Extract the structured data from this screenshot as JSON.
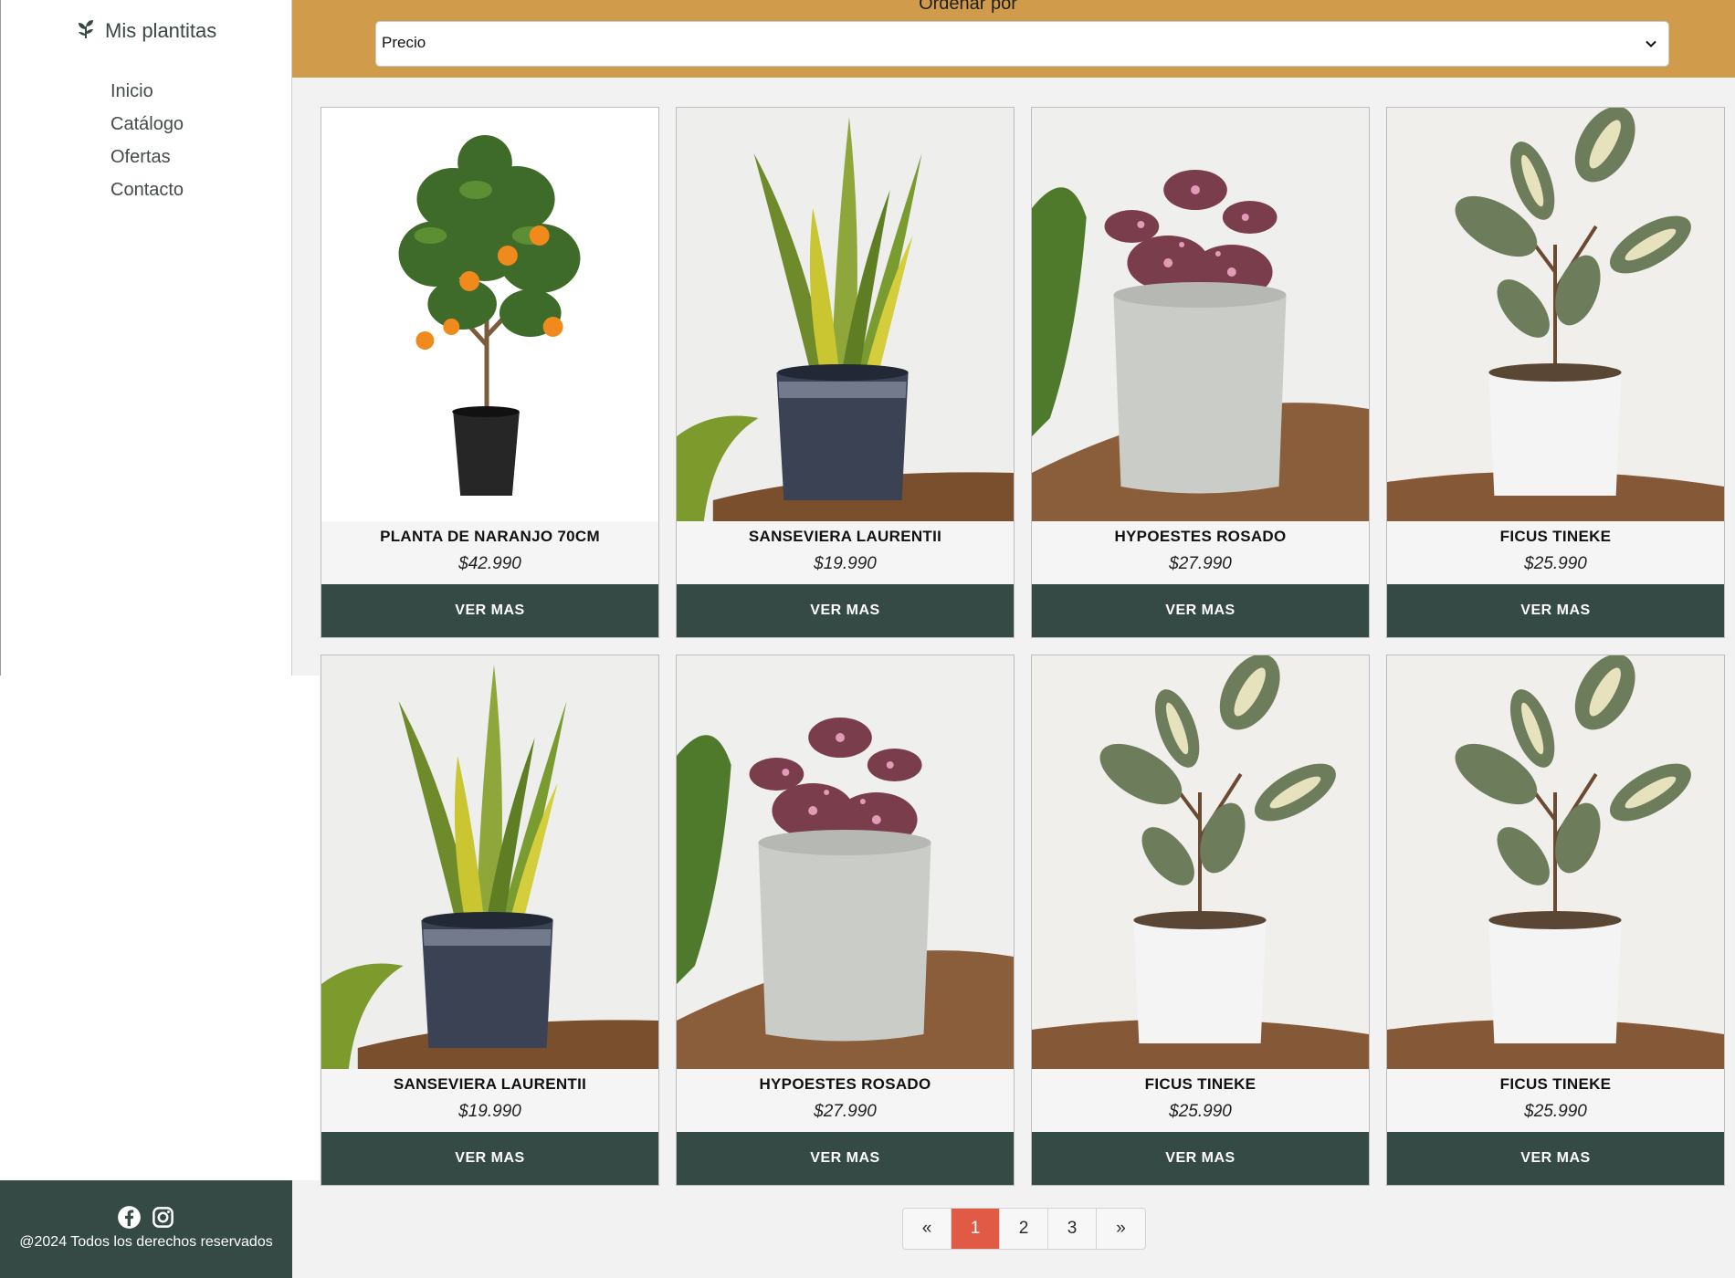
{
  "brand": {
    "name": "Mis plantitas",
    "icon": "sprout-icon"
  },
  "nav": [
    {
      "label": "Inicio"
    },
    {
      "label": "Catálogo"
    },
    {
      "label": "Ofertas"
    },
    {
      "label": "Contacto"
    }
  ],
  "sort": {
    "label": "Ordenar por",
    "selected": "Precio"
  },
  "products": [
    {
      "name": "PLANTA DE NARANJO 70CM",
      "price": "$42.990",
      "button": "VER MAS",
      "image": "orange-tree"
    },
    {
      "name": "SANSEVIERA LAURENTII",
      "price": "$19.990",
      "button": "VER MAS",
      "image": "snake-plant"
    },
    {
      "name": "HYPOESTES ROSADO",
      "price": "$27.990",
      "button": "VER MAS",
      "image": "polka-dot-plant"
    },
    {
      "name": "FICUS TINEKE",
      "price": "$25.990",
      "button": "VER MAS",
      "image": "ficus"
    },
    {
      "name": "SANSEVIERA LAURENTII",
      "price": "$19.990",
      "button": "VER MAS",
      "image": "snake-plant"
    },
    {
      "name": "HYPOESTES ROSADO",
      "price": "$27.990",
      "button": "VER MAS",
      "image": "polka-dot-plant"
    },
    {
      "name": "FICUS TINEKE",
      "price": "$25.990",
      "button": "VER MAS",
      "image": "ficus"
    },
    {
      "name": "FICUS TINEKE",
      "price": "$25.990",
      "button": "VER MAS",
      "image": "ficus"
    }
  ],
  "pagination": {
    "prev": "«",
    "pages": [
      "1",
      "2",
      "3"
    ],
    "current": "1",
    "next": "»"
  },
  "footer": {
    "copyright": "@2024 Todos los derechos reservados",
    "socials": [
      "facebook-icon",
      "instagram-icon"
    ]
  },
  "colors": {
    "topbar": "#d19b4c",
    "button": "#364a45",
    "active_page": "#e05a45"
  }
}
